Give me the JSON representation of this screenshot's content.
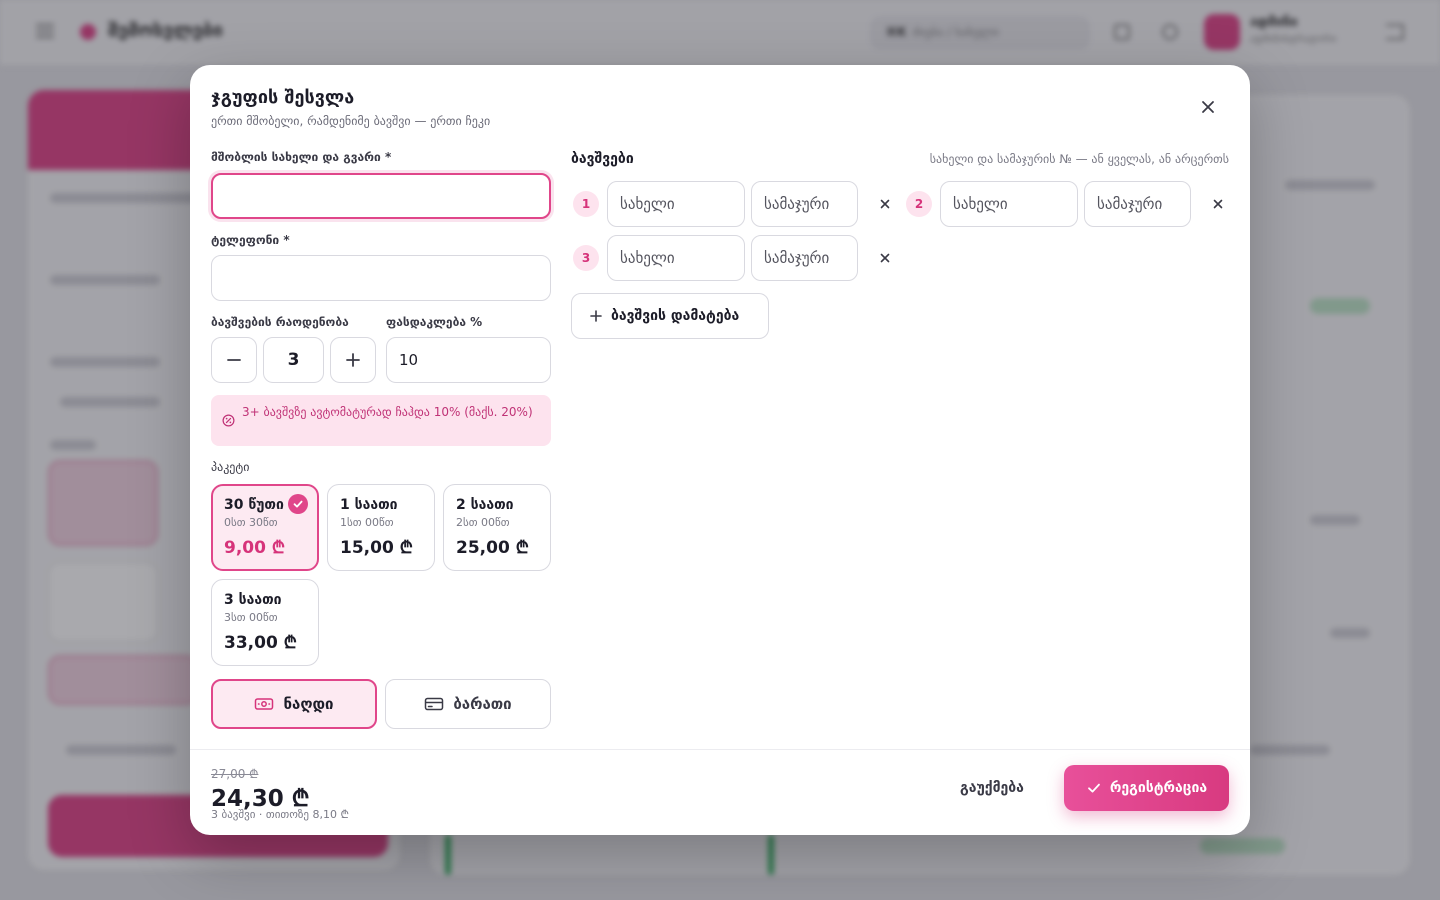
{
  "background": {
    "brand": "შემოსვლები",
    "search_placeholder": "ძიება / სახელი",
    "search_kbd": "⌘K",
    "user_name": "ადმინი",
    "user_role": "ადმინისტრატორი"
  },
  "modal": {
    "title": "ჯგუფის შესვლა",
    "subtitle": "ერთი მშობელი, რამდენიმე ბავშვი — ერთი ჩეკი",
    "parent": {
      "label": "მშობლის სახელი და გვარი *",
      "value": "",
      "placeholder": ""
    },
    "phone": {
      "label": "ტელეფონი *",
      "value": "",
      "placeholder": ""
    },
    "count": {
      "label": "ბავშვების რაოდენობა",
      "value": "3"
    },
    "discount": {
      "label": "ფასდაკლება %",
      "value": "10"
    },
    "notice": "3+ ბავშვზე ავტომატურად ჩაჰდა 10% (მაქს. 20%)",
    "packages_label": "პაკეტი",
    "packages": [
      {
        "name": "30 წუთი",
        "duration": "0სთ 30წთ",
        "price": "9,00 ₾",
        "selected": true
      },
      {
        "name": "1 საათი",
        "duration": "1სთ 00წთ",
        "price": "15,00 ₾",
        "selected": false
      },
      {
        "name": "2 საათი",
        "duration": "2სთ 00წთ",
        "price": "25,00 ₾",
        "selected": false
      },
      {
        "name": "3 საათი",
        "duration": "3სთ 00წთ",
        "price": "33,00 ₾",
        "selected": false
      }
    ],
    "payment": {
      "cash": "ნაღდი",
      "card": "ბარათი",
      "selected": "cash"
    },
    "kids": {
      "title": "ბავშვები",
      "hint": "სახელი და სამაჯურის № — ან ყველას, ან არცერთს",
      "name_placeholder": "სახელი",
      "bracelet_placeholder": "სამაჯური",
      "list": [
        {
          "number": "1",
          "name": "",
          "bracelet": ""
        },
        {
          "number": "2",
          "name": "",
          "bracelet": ""
        },
        {
          "number": "3",
          "name": "",
          "bracelet": ""
        }
      ],
      "add_label": "ბავშვის დამატება"
    },
    "footer": {
      "old_total": "27,00 ₾",
      "total": "24,30 ₾",
      "per_child": "3 ბავშვი · თითოზე 8,10 ₾",
      "cancel": "გაუქმება",
      "submit": "რეგისტრაცია"
    }
  },
  "colors": {
    "accent": "#e0468a",
    "accent_light": "#fdeaf2"
  }
}
